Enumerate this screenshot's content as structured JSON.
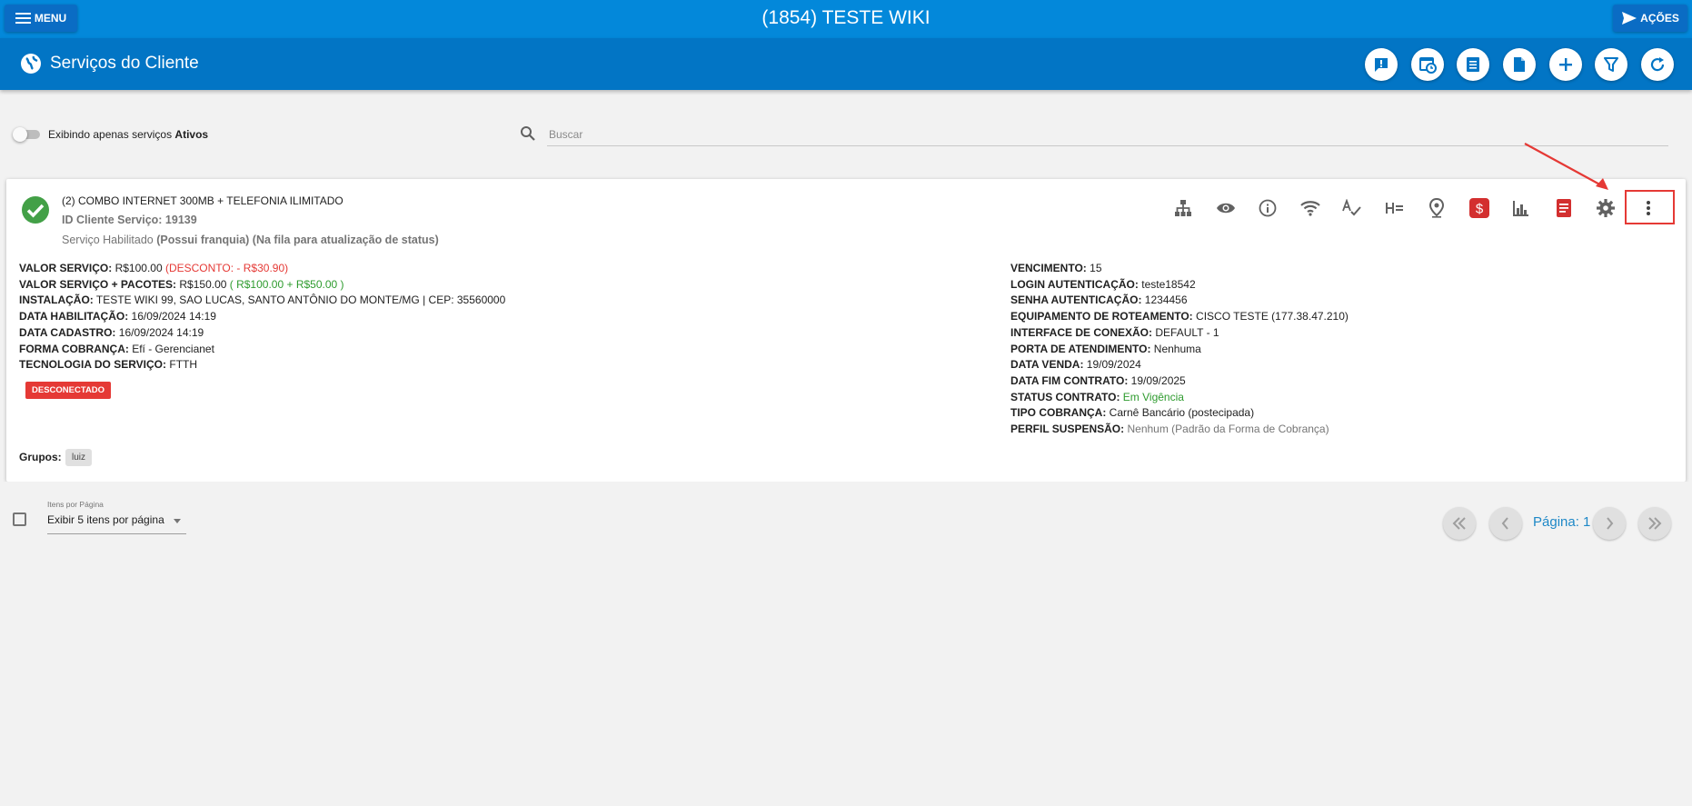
{
  "topbar": {
    "menu_label": "MENU",
    "title": "(1854) TESTE WIKI",
    "acoes_label": "AÇÕES"
  },
  "subbar": {
    "title": "Serviços do Cliente",
    "action_icons": [
      "alert-message-icon",
      "calendar-clock-icon",
      "list-icon",
      "document-icon",
      "plus-icon",
      "filter-icon",
      "refresh-icon"
    ]
  },
  "filter": {
    "toggle_text": "Exibindo apenas serviços",
    "toggle_bold": "Ativos",
    "search_placeholder": "Buscar"
  },
  "service": {
    "name": "(2) COMBO INTERNET 300MB + TELEFONIA ILIMITADO",
    "id_label": "ID Cliente Serviço: 19139",
    "status_text": "Serviço Habilitado",
    "status_extra": "(Possui franquia) (Na fila para atualização de status)",
    "action_icons": [
      "network-tree-icon",
      "eye-icon",
      "info-icon",
      "wifi-icon",
      "spellcheck-icon",
      "h-equal-icon",
      "map-pin-icon",
      "dollar-icon",
      "bar-chart-icon",
      "receipt-icon",
      "gear-icon",
      "more-vertical-icon"
    ],
    "left_info": {
      "valor_label": "VALOR SERVIÇO:",
      "valor_value": "R$100.00",
      "valor_desconto": "(DESCONTO: - R$30.90)",
      "pacotes_label": "VALOR SERVIÇO + PACOTES:",
      "pacotes_value": "R$150.00",
      "pacotes_detail": "( R$100.00 + R$50.00 )",
      "instalacao_label": "INSTALAÇÃO:",
      "instalacao_value": "TESTE WIKI 99, SAO LUCAS, SANTO ANTÔNIO DO MONTE/MG | CEP: 35560000",
      "habilitacao_label": "DATA HABILITAÇÃO:",
      "habilitacao_value": "16/09/2024 14:19",
      "cadastro_label": "DATA CADASTRO:",
      "cadastro_value": "16/09/2024 14:19",
      "cobranca_label": "FORMA COBRANÇA:",
      "cobranca_value": "Efí - Gerencianet",
      "tecnologia_label": "TECNOLOGIA DO SERVIÇO:",
      "tecnologia_value": "FTTH"
    },
    "badge": "DESCONECTADO",
    "right_info": {
      "vencimento_label": "VENCIMENTO:",
      "vencimento_value": "15",
      "login_label": "LOGIN AUTENTICAÇÃO:",
      "login_value": "teste18542",
      "senha_label": "SENHA AUTENTICAÇÃO:",
      "senha_value": "1234456",
      "equip_label": "EQUIPAMENTO DE ROTEAMENTO:",
      "equip_value": "CISCO TESTE (177.38.47.210)",
      "interface_label": "INTERFACE DE CONEXÃO:",
      "interface_value": "DEFAULT - 1",
      "porta_label": "PORTA DE ATENDIMENTO:",
      "porta_value": "Nenhuma",
      "venda_label": "DATA VENDA:",
      "venda_value": "19/09/2024",
      "fim_label": "DATA FIM CONTRATO:",
      "fim_value": "19/09/2025",
      "status_label": "STATUS CONTRATO:",
      "status_value": "Em Vigência",
      "tipo_label": "TIPO COBRANÇA:",
      "tipo_value": "Carnê Bancário (postecipada)",
      "perfil_label": "PERFIL SUSPENSÃO:",
      "perfil_value": "Nenhum (Padrão da Forma de Cobrança)"
    },
    "groups_label": "Grupos:",
    "group_chip": "luiz"
  },
  "pagination": {
    "items_label": "Itens por Página",
    "items_value": "Exibir 5 itens por página",
    "page_label": "Página: 1"
  },
  "colors": {
    "topbar": "#0388da",
    "subbar": "#0275c5",
    "accent_red": "#e53935",
    "status_green": "#2e9b2e"
  }
}
